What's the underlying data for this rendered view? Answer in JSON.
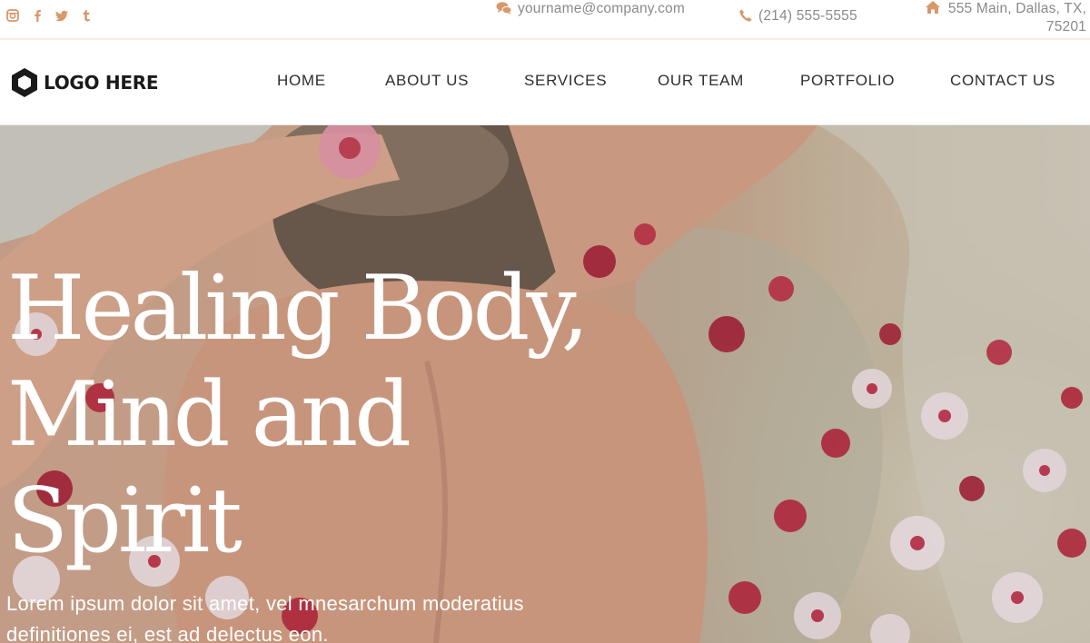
{
  "topbar": {
    "social": [
      {
        "icon": "instagram-icon"
      },
      {
        "icon": "facebook-icon"
      },
      {
        "icon": "twitter-icon"
      },
      {
        "icon": "tumblr-icon"
      }
    ],
    "email": "yourname@company.com",
    "phone": "(214) 555-5555",
    "address": "555 Main, Dallas, TX, 75201",
    "icon_color": "#d9986a"
  },
  "nav": {
    "logo_text": "LOGO HERE",
    "items": [
      "HOME",
      "ABOUT US",
      "SERVICES",
      "OUR TEAM",
      "PORTFOLIO",
      "CONTACT US"
    ]
  },
  "hero": {
    "title_lines": [
      "Healing Body,",
      "Mind and",
      "Spirit"
    ],
    "subtitle": "Lorem ipsum dolor sit amet, vel mnesarchum moderatius definitiones ei, est ad delectus eon."
  }
}
